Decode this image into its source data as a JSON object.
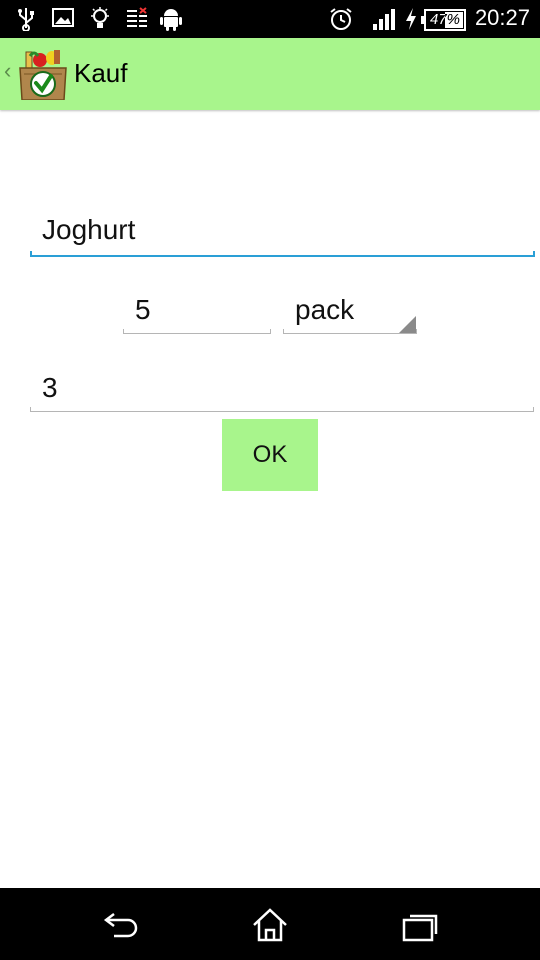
{
  "status_bar": {
    "icons": [
      "usb-icon",
      "image-icon",
      "lightbulb-icon",
      "checklist-icon",
      "android-icon",
      "alarm-icon",
      "signal-icon",
      "charging-icon"
    ],
    "battery": "47%",
    "time": "20:27"
  },
  "action_bar": {
    "title": "Kauf",
    "back_icon": "chevron-left-icon",
    "logo_icon": "shopping-basket-icon"
  },
  "form": {
    "item_name": "Joghurt",
    "quantity": "5",
    "unit": "pack",
    "third_field": "3",
    "ok_label": "OK"
  },
  "nav_bar": {
    "icons": [
      "back-icon",
      "home-icon",
      "recents-icon"
    ]
  },
  "colors": {
    "accent_green": "#a8f58c",
    "focus_blue": "#2a9fd6",
    "bar_black": "#000000"
  }
}
